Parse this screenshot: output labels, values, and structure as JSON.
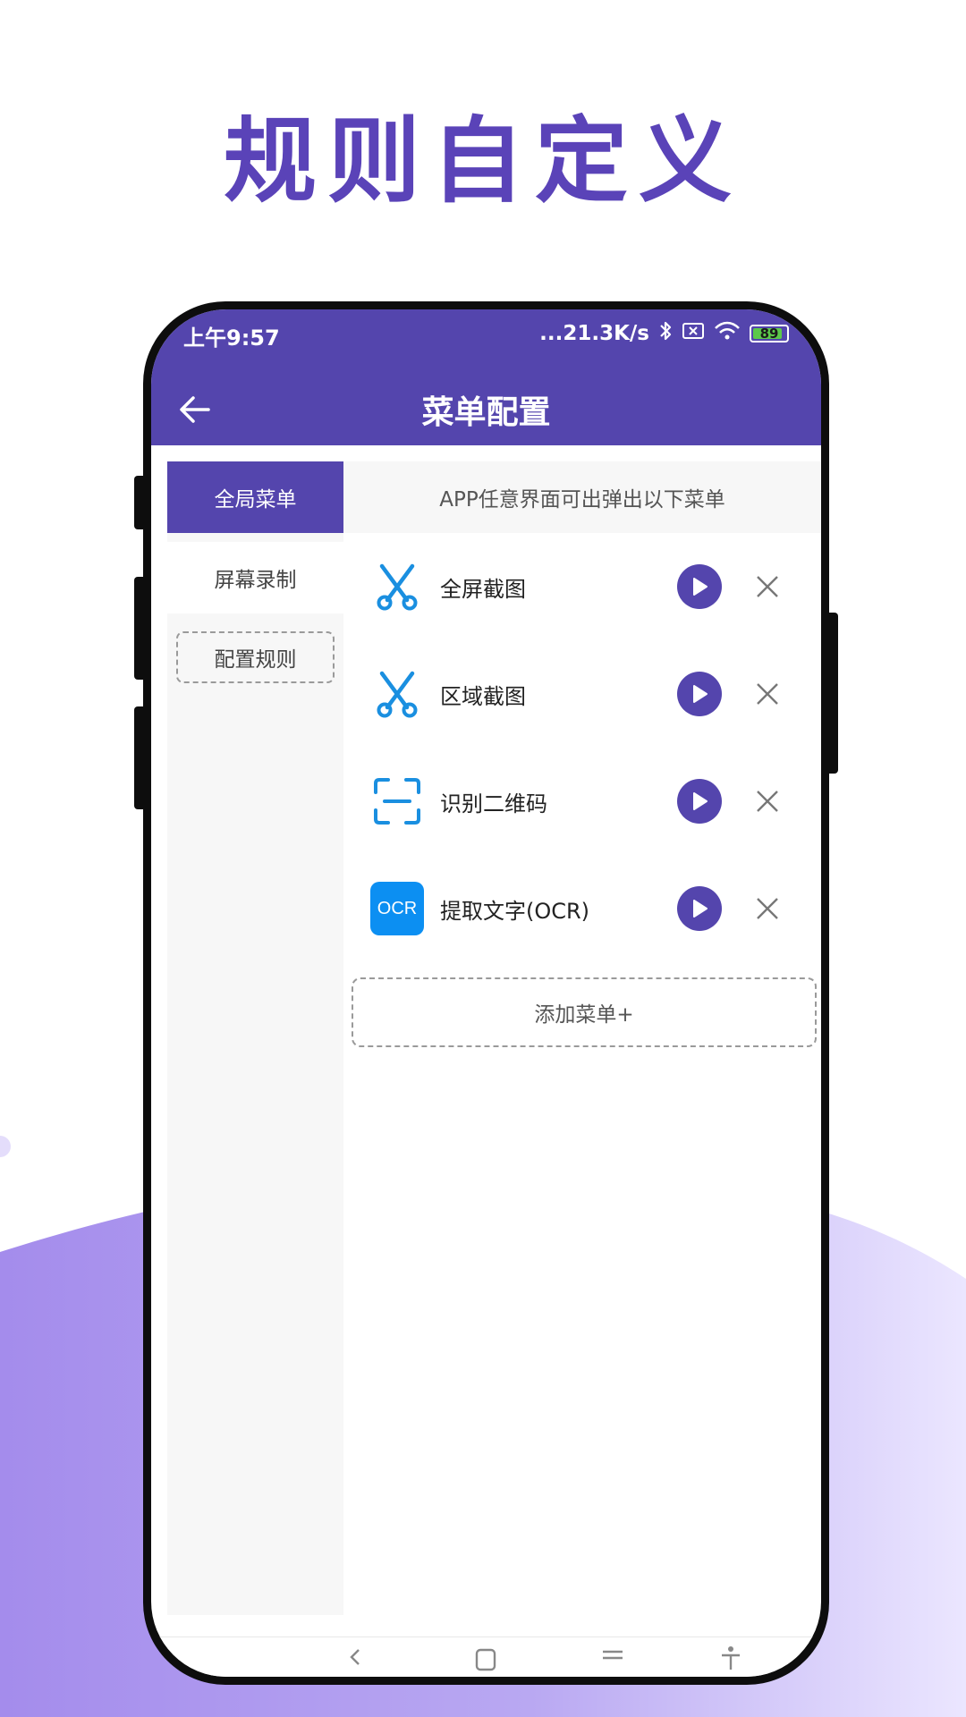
{
  "headline": "规则自定义",
  "colors": {
    "brand": "#5445ad",
    "headline": "#5a43b8",
    "accent_blue": "#1a8fe0",
    "ocr_badge": "#0c8ff2"
  },
  "status_bar": {
    "time": "上午9:57",
    "network_speed": "...21.3K/s",
    "battery": "89",
    "icons": [
      "bluetooth-icon",
      "sim-icon",
      "wifi-icon",
      "battery-icon"
    ]
  },
  "appbar": {
    "title": "菜单配置",
    "back_icon": "arrow-left-icon"
  },
  "sidebar": {
    "items": [
      {
        "label": "全局菜单",
        "active": true
      },
      {
        "label": "屏幕录制",
        "active": false
      },
      {
        "label": "配置规则",
        "active": false
      }
    ]
  },
  "main": {
    "hint": "APP任意界面可出弹出以下菜单",
    "menus": [
      {
        "label": "全屏截图",
        "icon": "scissors-icon"
      },
      {
        "label": "区域截图",
        "icon": "scissors-icon"
      },
      {
        "label": "识别二维码",
        "icon": "qr-scan-icon"
      },
      {
        "label": "提取文字(OCR)",
        "icon": "ocr-icon",
        "badge": "OCR"
      }
    ],
    "add_label": "添加菜单+"
  }
}
